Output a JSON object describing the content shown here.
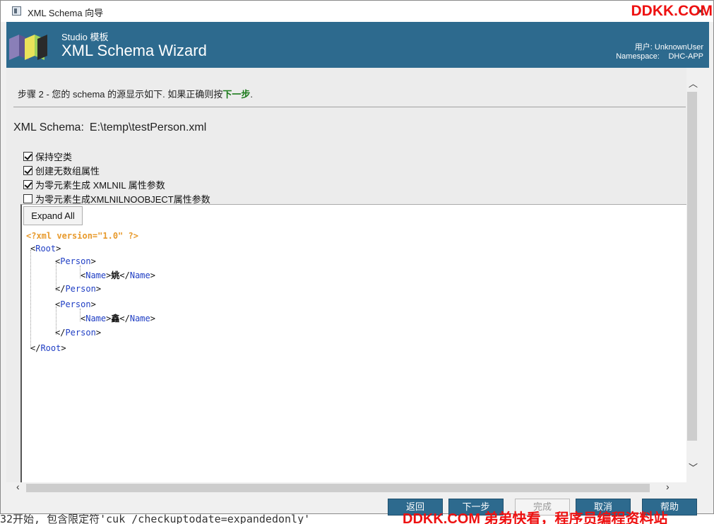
{
  "window": {
    "title": "XML Schema 向导"
  },
  "banner": {
    "studio_label": "Studio 模板",
    "wizard_title": "XML Schema Wizard",
    "user_text": "用户: UnknownUser",
    "namespace_label": "Namespace:",
    "namespace_value": "DHC-APP",
    "color": "#2d6a8e"
  },
  "step": {
    "prefix": "步骤 2 - 您的 schema 的源显示如下. 如果正确则按",
    "next_word": "下一步",
    "suffix": "."
  },
  "schema": {
    "label": "XML Schema:",
    "path": "E:\\temp\\testPerson.xml"
  },
  "options": [
    {
      "label": "保持空类",
      "checked": true
    },
    {
      "label": "创建无数组属性",
      "checked": true
    },
    {
      "label": "为零元素生成 XMLNIL 属性参数",
      "checked": true
    },
    {
      "label": "为零元素生成XMLNILNOOBJECT属性参数",
      "checked": false
    }
  ],
  "editor": {
    "expand_all": "Expand All",
    "pi": "<?xml version=\"1.0\" ?>",
    "root_tag": "Root",
    "person_tag": "Person",
    "name_tag": "Name",
    "person1_name": "姚",
    "person2_name": "鑫"
  },
  "buttons": {
    "back": "返回",
    "next": "下一步",
    "finish": "完成",
    "cancel": "取消",
    "help": "帮助"
  },
  "watermarks": {
    "top": "DDKK.COM",
    "bottom": "DDKK.COM 弟弟快看，程序员编程资料站"
  },
  "background": {
    "bottom_text": "32开始, 包含限定符'cuk /checkuptodate=expandedonly'"
  }
}
